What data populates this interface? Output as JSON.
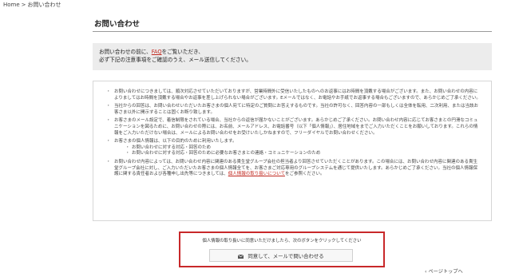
{
  "breadcrumb": {
    "home": "Home",
    "separator": ">",
    "current": "お問い合わせ"
  },
  "page": {
    "title": "お問い合わせ"
  },
  "intro": {
    "line1_before": "お問い合わせの前に、",
    "faq_link": "FAQ",
    "line1_after": "をご覧いただき、",
    "line2": "必ず下記の注意事項をご確認のうえ、メール送信してください。"
  },
  "notices": [
    {
      "text": "お問い合わせにつきましては、順次対応させていただいておりますが、営業時間外に受信いたしたものへのお返事にはお時間を頂戴する場合がございます。また、お問い合わせの内容によりましてはお時間を頂戴する場合やお返事を差し上げられない場合がございます。Eメールではなく、お電話やお手紙でお返事する場合もございますので、あらかじめご了承ください。"
    },
    {
      "text": "当社からの回答は、お問い合わせいただいたお客さまの個人宛てに特定のご質問にお答えするものです。当社の許可なく、回答内容の一部もしくは全体を転用、二次利用、または当該お客さま以外に開示することは固くお断り致します。"
    },
    {
      "text": "お客さまのメール設定で、着信制限をされている場合、当社からの返信が届かないことがございます。あらかじめご了承ください。お問い合わせ内容に応じてお客さまとの円滑なコミュニケーションを図るために、お問い合わせの際には、お名前、メールアドレス、お電話番号（以下「個人情報」）、居住地域をまでご入力いただくことをお願いしております。これらの情報をご入力いただけない場合は、メールによるお問い合わせをお受けいたしかねますので、フリーダイヤルでお問い合わせください。"
    },
    {
      "text": "お客さまの個人情報は、以下の目的のために利用いたします。",
      "sub": [
        "お問い合わせに対する対応・回答のため",
        "お問い合わせに対する対応・回答のために必要なお客さまとの連絡・コミュニケーションのため"
      ]
    },
    {
      "text_before": "お問い合わせ内容によっては、お問い合わせ内容に関連のある貴生堂グループ会社の担当者より回答させていただくことがあります。この場合には、お問い合わせ内容に関連のある貴生堂グループ会社に対し、ご入力いただいたお客さまの個人情報全てを、お客さまご対応専用のグループシステムを通じて提供いたします。あらかじめご了承ください。当社の個人情報保護に関する責任者および各種申し出先等につきましては、",
      "link": "個人情報の取り扱いについて",
      "text_after": "をご参照ください。"
    }
  ],
  "consent": {
    "text": "個人情報の取り扱いに同意いただけましたら、次のボタンをクリックしてください",
    "button_label": "同意して、メールで問い合わせる"
  },
  "page_top": {
    "label": "ページトップへ"
  },
  "colors": {
    "accent": "#c8282a",
    "link": "#c0281f",
    "intro_bg": "#ececec"
  }
}
